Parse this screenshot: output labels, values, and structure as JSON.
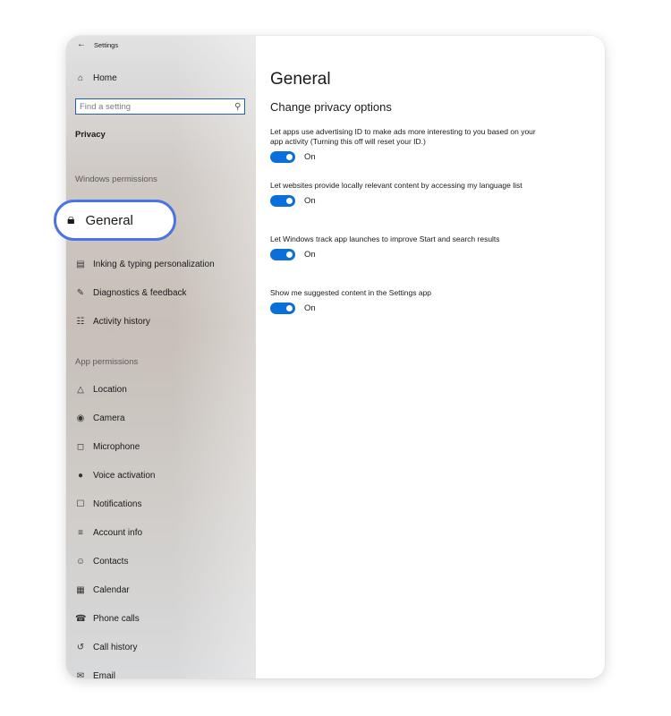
{
  "window": {
    "title": "Settings"
  },
  "sidebar": {
    "home_label": "Home",
    "search_placeholder": "Find a setting",
    "category": "Privacy",
    "windows_permissions_heading": "Windows permissions",
    "selected_item": "General",
    "windows_items": [
      {
        "label": "Inking & typing personalization",
        "icon": "notebook-icon"
      },
      {
        "label": "Diagnostics & feedback",
        "icon": "feedback-icon"
      },
      {
        "label": "Activity history",
        "icon": "timeline-icon"
      }
    ],
    "app_permissions_heading": "App permissions",
    "app_items": [
      {
        "label": "Location",
        "icon": "location-icon"
      },
      {
        "label": "Camera",
        "icon": "camera-icon"
      },
      {
        "label": "Microphone",
        "icon": "microphone-icon"
      },
      {
        "label": "Voice activation",
        "icon": "voice-icon"
      },
      {
        "label": "Notifications",
        "icon": "notification-icon"
      },
      {
        "label": "Account info",
        "icon": "account-info-icon"
      },
      {
        "label": "Contacts",
        "icon": "contacts-icon"
      },
      {
        "label": "Calendar",
        "icon": "calendar-icon"
      },
      {
        "label": "Phone calls",
        "icon": "phone-icon"
      },
      {
        "label": "Call history",
        "icon": "history-icon"
      },
      {
        "label": "Email",
        "icon": "email-icon"
      }
    ]
  },
  "main": {
    "title": "General",
    "section_title": "Change privacy options",
    "options": [
      {
        "description": "Let apps use advertising ID to make ads more interesting to you based on your app activity (Turning this off will reset your ID.)",
        "state": "On"
      },
      {
        "description": "Let websites provide locally relevant content by accessing my language list",
        "state": "On"
      },
      {
        "description": "Let Windows track app launches to improve Start and search results",
        "state": "On"
      },
      {
        "description": "Show me suggested content in the Settings app",
        "state": "On"
      }
    ]
  },
  "colors": {
    "accent": "#0a6fd8",
    "highlight_ring": "#4a73e6",
    "search_border": "#1f5fbf"
  }
}
